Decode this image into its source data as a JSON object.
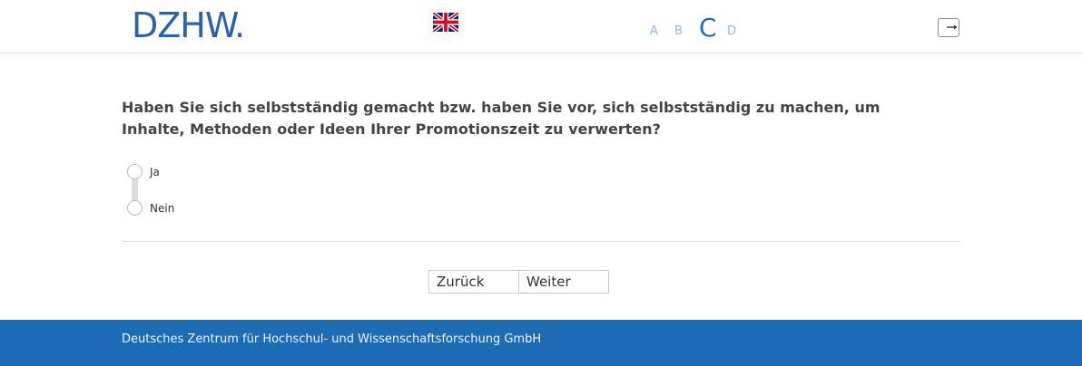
{
  "header": {
    "logo_text": "DZHW",
    "logo_dot": ".",
    "language_icon": "uk-flag-icon",
    "sections": [
      {
        "label": "A",
        "active": false
      },
      {
        "label": "B",
        "active": false
      },
      {
        "label": "C",
        "active": true
      },
      {
        "label": "D",
        "active": false
      }
    ],
    "logout_icon": "logout-arrow-icon"
  },
  "question": {
    "text": "Haben Sie sich selbstständig gemacht bzw. haben Sie vor, sich selbstständig zu machen, um Inhalte, Methoden oder Ideen Ihrer Promotionszeit zu verwerten?",
    "options": [
      {
        "label": "Ja",
        "selected": false
      },
      {
        "label": "Nein",
        "selected": false
      }
    ]
  },
  "nav": {
    "back_label": "Zurück",
    "next_label": "Weiter"
  },
  "footer": {
    "text": "Deutsches Zentrum für Hochschul- und Wissenschaftsforschung GmbH"
  },
  "colors": {
    "brand_blue": "#1e6db4",
    "section_inactive": "#8ab8e6",
    "section_active": "#1c6fc0"
  }
}
